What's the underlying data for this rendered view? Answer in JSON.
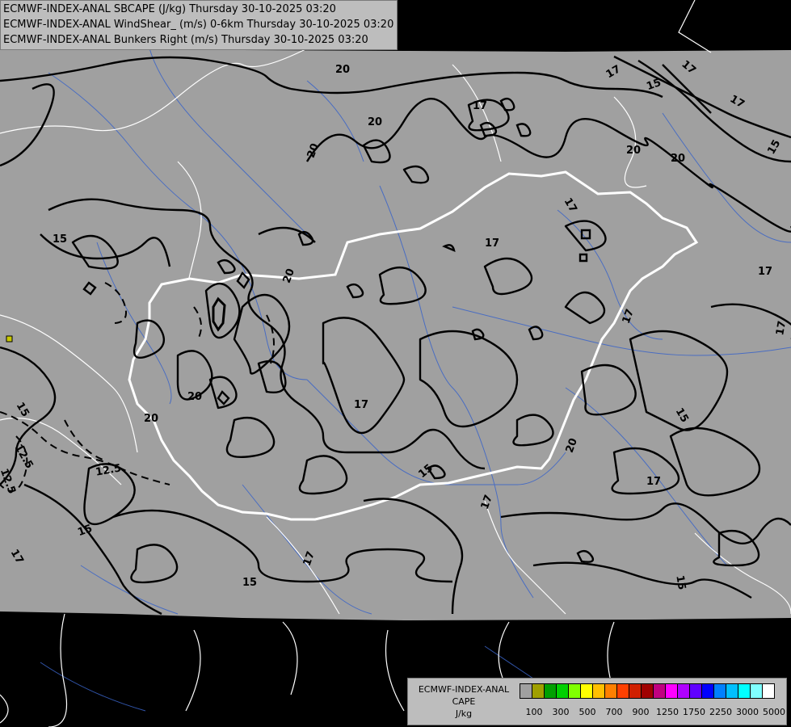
{
  "titles": [
    "ECMWF-INDEX-ANAL SBCAPE (J/kg) Thursday 30-10-2025 03:20",
    "ECMWF-INDEX-ANAL WindShear_ (m/s) 0-6km Thursday 30-10-2025 03:20",
    "ECMWF-INDEX-ANAL Bunkers Right (m/s) Thursday 30-10-2025 03:20"
  ],
  "legend": {
    "line1": "ECMWF-INDEX-ANAL",
    "line2": "CAPE",
    "line3": "J/kg",
    "colors": [
      "#a0a0a0",
      "#a0a000",
      "#00a000",
      "#00d000",
      "#80ff00",
      "#ffff00",
      "#ffc000",
      "#ff8000",
      "#ff4000",
      "#d02000",
      "#a00000",
      "#c00080",
      "#ff00ff",
      "#b000ff",
      "#6000ff",
      "#0000ff",
      "#0080ff",
      "#00c0ff",
      "#00ffff",
      "#80ffff",
      "#ffffff"
    ],
    "labels": [
      "100",
      "300",
      "500",
      "700",
      "900",
      "1250",
      "1750",
      "2250",
      "3000",
      "5000"
    ]
  },
  "map": {
    "field_color": "#a0a0a0",
    "background_color": "#000000",
    "contour_labels": [
      "20",
      "20",
      "20",
      "20",
      "20",
      "20",
      "20",
      "20",
      "20",
      "17",
      "17",
      "17",
      "17",
      "17",
      "17",
      "17",
      "17",
      "17",
      "17",
      "17",
      "17",
      "17",
      "17",
      "15",
      "15",
      "15",
      "15",
      "15",
      "15",
      "15",
      "15",
      "12.5",
      "12.5",
      "12.5"
    ]
  }
}
